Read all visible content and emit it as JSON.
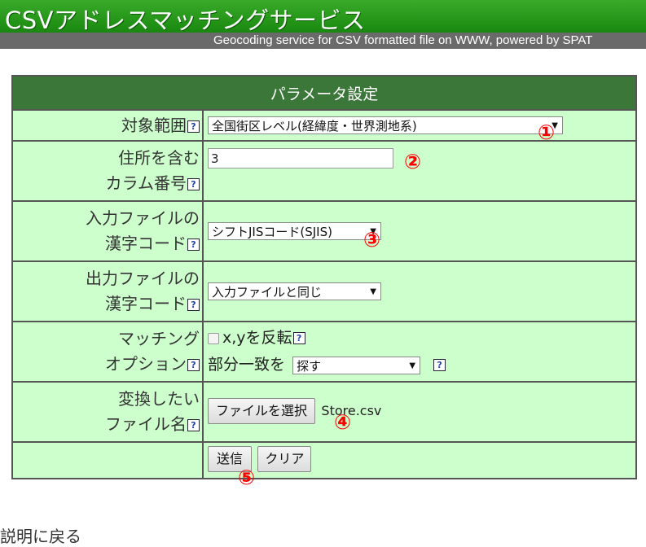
{
  "header": {
    "title": "CSVアドレスマッチングサービス",
    "subtitle": "Geocoding service for CSV formatted file on WWW, powered by SPAT"
  },
  "form": {
    "section_title": "パラメータ設定",
    "help_glyph": "?",
    "rows": {
      "scope": {
        "label": "対象範囲",
        "value": "全国街区レベル(経緯度・世界測地系)",
        "marker": "①"
      },
      "column": {
        "label_line1": "住所を含む",
        "label_line2": "カラム番号",
        "value": "3",
        "marker": "②"
      },
      "input_encoding": {
        "label_line1": "入力ファイルの",
        "label_line2": "漢字コード",
        "value": "シフトJISコード(SJIS)",
        "marker": "③"
      },
      "output_encoding": {
        "label_line1": "出力ファイルの",
        "label_line2": "漢字コード",
        "value": "入力ファイルと同じ"
      },
      "options": {
        "label_line1": "マッチング",
        "label_line2": "オプション",
        "swap_label": "x,yを反転",
        "swap_checked": false,
        "partial_label": "部分一致を",
        "partial_value": "探す"
      },
      "file": {
        "label_line1": "変換したい",
        "label_line2": "ファイル名",
        "button": "ファイルを選択",
        "filename": "Store.csv",
        "marker": "④"
      },
      "actions": {
        "submit": "送信",
        "clear": "クリア",
        "marker": "⑤"
      }
    }
  },
  "footer": {
    "back_link": "説明に戻る"
  },
  "colors": {
    "banner_green": "#1f8f14",
    "header_green": "#3c773a",
    "cell_bg": "#ccffcc",
    "marker_red": "#ff0000"
  }
}
